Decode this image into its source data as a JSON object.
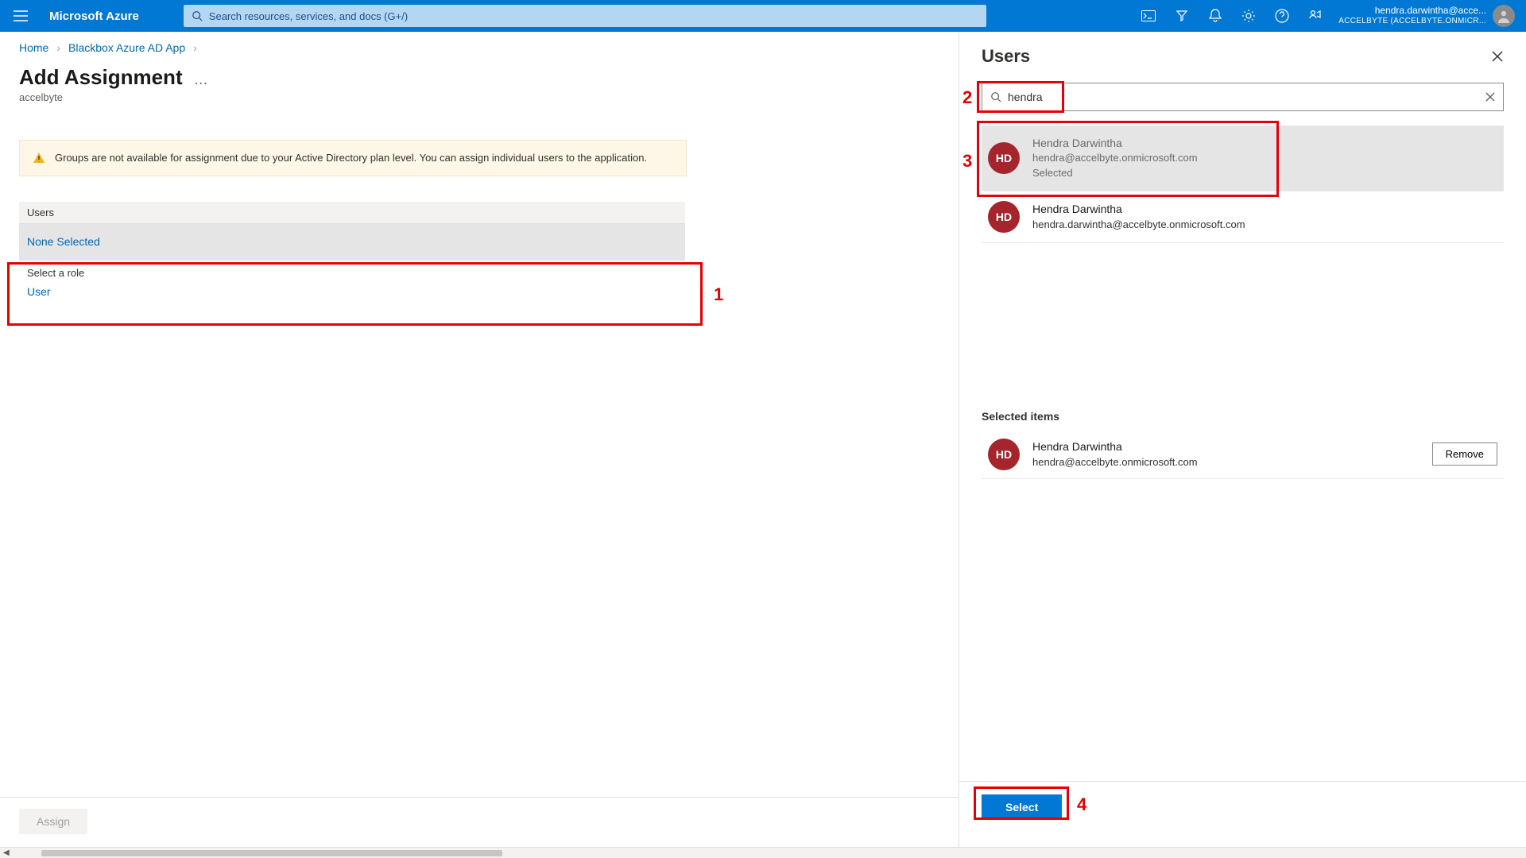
{
  "topbar": {
    "brand": "Microsoft Azure",
    "search_placeholder": "Search resources, services, and docs (G+/)",
    "account": {
      "line1": "hendra.darwintha@acce...",
      "line2": "ACCELBYTE (ACCELBYTE.ONMICR..."
    }
  },
  "breadcrumbs": {
    "home": "Home",
    "app": "Blackbox Azure AD App"
  },
  "page": {
    "title": "Add Assignment",
    "subtitle": "accelbyte"
  },
  "warning": "Groups are not available for assignment due to your Active Directory plan level. You can assign individual users to the application.",
  "selector": {
    "users_label": "Users",
    "none_selected": "None Selected",
    "role_label": "Select a role",
    "role_value": "User"
  },
  "buttons": {
    "assign": "Assign",
    "select": "Select",
    "remove": "Remove"
  },
  "flyout": {
    "title": "Users",
    "search_value": "hendra",
    "selected_label": "Selected",
    "selected_items_header": "Selected items",
    "results": [
      {
        "initials": "HD",
        "name": "Hendra Darwintha",
        "email": "hendra@accelbyte.onmicrosoft.com",
        "selected": true
      },
      {
        "initials": "HD",
        "name": "Hendra Darwintha",
        "email": "hendra.darwintha@accelbyte.onmicrosoft.com",
        "selected": false
      }
    ],
    "selected_items": [
      {
        "initials": "HD",
        "name": "Hendra Darwintha",
        "email": "hendra@accelbyte.onmicrosoft.com"
      }
    ]
  },
  "annotations": {
    "n1": "1",
    "n2": "2",
    "n3": "3",
    "n4": "4"
  }
}
